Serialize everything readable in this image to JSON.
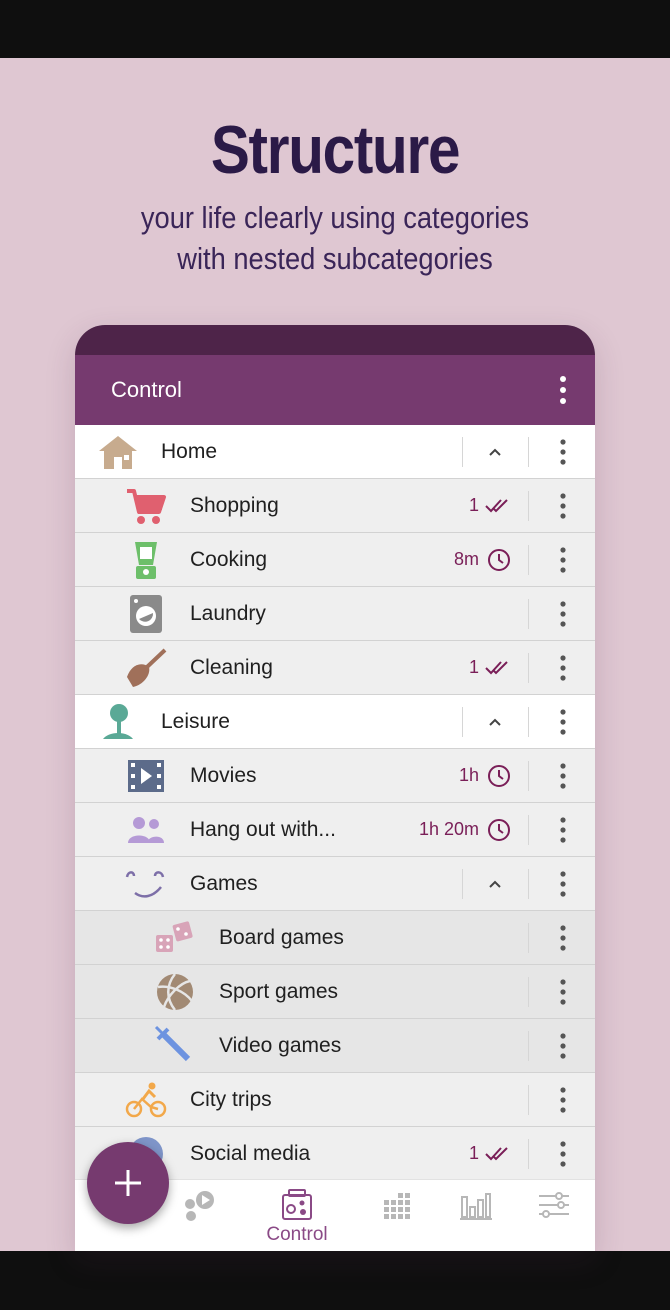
{
  "promo": {
    "headline": "Structure",
    "subline_1": "your life clearly using categories",
    "subline_2": "with nested subcategories"
  },
  "appbar": {
    "title": "Control",
    "menu_icon": "more-vert-icon"
  },
  "colors": {
    "appbar": "#763a6f",
    "status": "#4e2449",
    "accent": "#7a1f58",
    "background": "#dfc7d2"
  },
  "rows": [
    {
      "label": "Home",
      "icon": "house-icon",
      "level": 0,
      "expanded": true,
      "value": ""
    },
    {
      "label": "Shopping",
      "icon": "shopping-cart-icon",
      "level": 1,
      "value": "1",
      "status": "double-check-icon"
    },
    {
      "label": "Cooking",
      "icon": "blender-icon",
      "level": 1,
      "value": "8m",
      "status": "clock-icon"
    },
    {
      "label": "Laundry",
      "icon": "washing-machine-icon",
      "level": 1,
      "value": ""
    },
    {
      "label": "Cleaning",
      "icon": "broom-icon",
      "level": 1,
      "value": "1",
      "status": "double-check-icon"
    },
    {
      "label": "Leisure",
      "icon": "tree-icon",
      "level": 0,
      "expanded": true,
      "value": ""
    },
    {
      "label": "Movies",
      "icon": "film-icon",
      "level": 1,
      "value": "1h",
      "status": "clock-icon"
    },
    {
      "label": "Hang out with...",
      "icon": "people-icon",
      "level": 1,
      "value": "1h 20m",
      "status": "clock-icon"
    },
    {
      "label": "Games",
      "icon": "smiley-icon",
      "level": 1,
      "expanded": true,
      "value": ""
    },
    {
      "label": "Board games",
      "icon": "dice-icon",
      "level": 2,
      "value": ""
    },
    {
      "label": "Sport games",
      "icon": "volleyball-icon",
      "level": 2,
      "value": ""
    },
    {
      "label": "Video games",
      "icon": "sword-icon",
      "level": 2,
      "value": ""
    },
    {
      "label": "City trips",
      "icon": "bicycle-icon",
      "level": 1,
      "value": ""
    },
    {
      "label": "Social media",
      "icon": "globe-icon",
      "level": 1,
      "value": "1",
      "status": "double-check-icon"
    }
  ],
  "bottom_nav": [
    {
      "icon": "activities-icon",
      "label": ""
    },
    {
      "icon": "control-icon",
      "label": "Control",
      "active": true
    },
    {
      "icon": "grid-icon",
      "label": ""
    },
    {
      "icon": "bar-chart-icon",
      "label": ""
    },
    {
      "icon": "sliders-icon",
      "label": ""
    }
  ],
  "fab": {
    "icon": "plus-icon"
  }
}
